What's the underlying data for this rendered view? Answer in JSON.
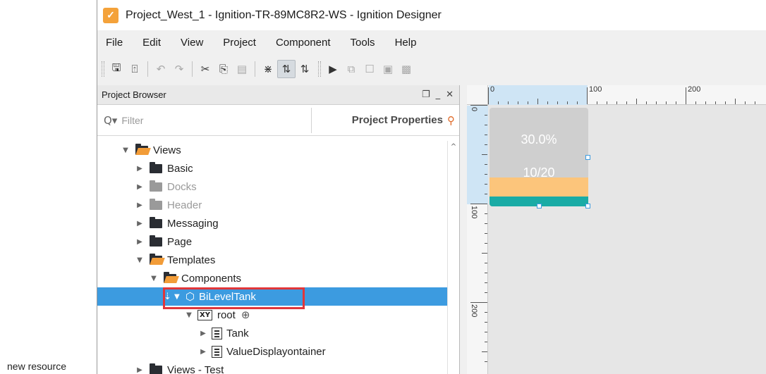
{
  "caption_text": "new resource",
  "window": {
    "title": "Project_West_1 - Ignition-TR-89MC8R2-WS - Ignition Designer",
    "app_icon_glyph": "✓"
  },
  "menu": [
    "File",
    "Edit",
    "View",
    "Project",
    "Component",
    "Tools",
    "Help"
  ],
  "toolbar": {
    "icons": [
      "save-icon",
      "save-all-icon",
      "undo-icon",
      "redo-icon",
      "cut-icon",
      "copy-icon",
      "paste-icon",
      "snap-icon",
      "mode-a-icon",
      "mode-b-icon",
      "play-icon",
      "group-icon",
      "ungroup-icon",
      "front-icon",
      "back-icon"
    ],
    "glyphs": {
      "save": "🖫",
      "save_all": "⍐",
      "undo": "↶",
      "redo": "↷",
      "cut": "✂",
      "copy": "⎘",
      "paste": "▤",
      "snap": "⋇",
      "mode_a": "⇅",
      "mode_b": "⇅",
      "play": "▶",
      "group": "⧉",
      "ungroup": "☐",
      "front": "▣",
      "back": "▩"
    }
  },
  "project_browser": {
    "title": "Project Browser",
    "restore_glyph": "❐",
    "minimize_glyph": "_",
    "close_glyph": "✕",
    "search_glyph": "Q▾",
    "filter_placeholder": "Filter",
    "properties_label": "Project Properties",
    "properties_glyph": "⚲",
    "tree": [
      {
        "label": "Views",
        "toggle": "▼",
        "icon": "open",
        "dim": false
      },
      {
        "label": "Basic",
        "toggle": "▶",
        "icon": "folder",
        "dim": false
      },
      {
        "label": "Docks",
        "toggle": "▶",
        "icon": "grey",
        "dim": true
      },
      {
        "label": "Header",
        "toggle": "▶",
        "icon": "grey",
        "dim": true
      },
      {
        "label": "Messaging",
        "toggle": "▶",
        "icon": "folder",
        "dim": false
      },
      {
        "label": "Page",
        "toggle": "▶",
        "icon": "folder",
        "dim": false
      },
      {
        "label": "Templates",
        "toggle": "▼",
        "icon": "open",
        "dim": false
      },
      {
        "label": "Components",
        "toggle": "▼",
        "icon": "open",
        "dim": false
      },
      {
        "label": "BiLevelTank",
        "toggle": "▼",
        "icon": "cube",
        "dim": false,
        "selected": true
      },
      {
        "label": "root",
        "toggle": "▼",
        "icon": "xy",
        "dim": false
      },
      {
        "label": "Tank",
        "toggle": "▶",
        "icon": "component",
        "dim": false
      },
      {
        "label": "ValueDisplayontainer",
        "toggle": "▶",
        "icon": "component",
        "dim": false
      },
      {
        "label": "Views - Test",
        "toggle": "▶",
        "icon": "folder",
        "dim": false
      }
    ],
    "scroll_up_glyph": "^"
  },
  "canvas": {
    "ruler_top_labels": [
      "0",
      "100",
      "200"
    ],
    "ruler_left_labels": [
      "0",
      "100",
      "200"
    ],
    "tank": {
      "percent_text": "30.0%",
      "value_text": "10/20",
      "level_fraction": 0.3,
      "fill_color": "#1aaba5",
      "warning_color": "#fcc57b"
    }
  },
  "colors": {
    "selection": "#3c9be0",
    "highlight_box": "#e0363a",
    "accent": "#f29c38"
  }
}
